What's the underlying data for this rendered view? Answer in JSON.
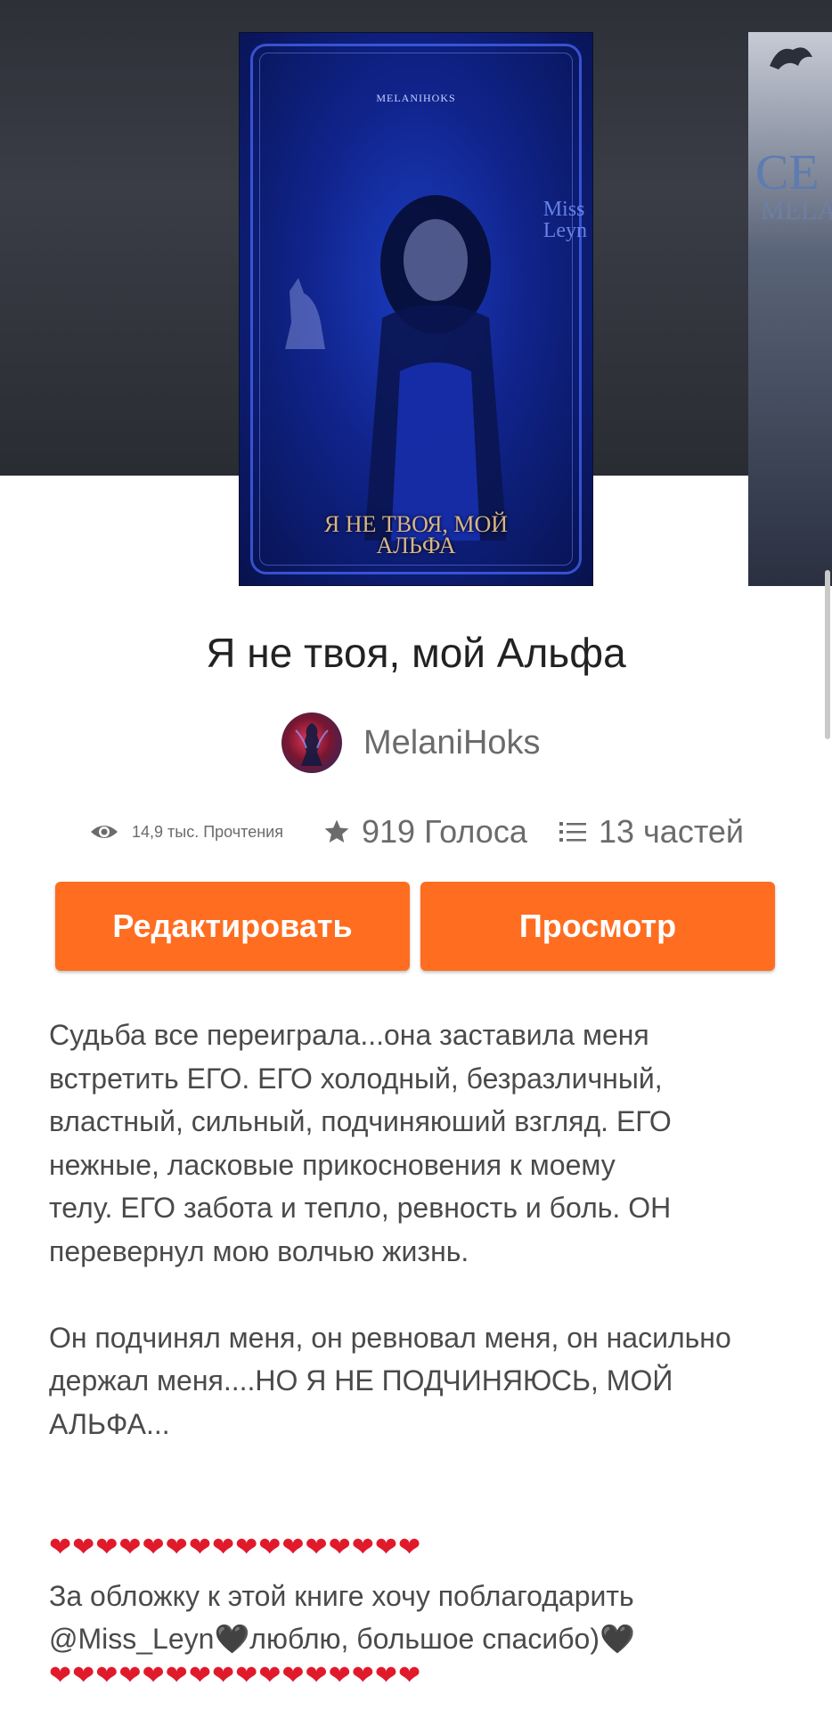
{
  "cover": {
    "author_label": "MELANIHOKS",
    "signature": "Miss\nLeyn",
    "title_line1": "Я НЕ ТВОЯ, МОЙ",
    "title_line2": "АЛЬФА"
  },
  "side_cover": {
    "text1": "CE",
    "text2": "MELA"
  },
  "story": {
    "title": "Я не твоя, мой Альфа",
    "author": "MelaniHoks"
  },
  "stats": {
    "reads": "14,9 тыс. Прочтения",
    "votes": "919 Голоса",
    "parts": "13 частей"
  },
  "buttons": {
    "edit": "Редактировать",
    "view": "Просмотр"
  },
  "description": {
    "para1": "Судьба все переиграла...она заставила меня\nвстретить ЕГО. ЕГО холодный, безразличный,\nвластный, сильный, подчиняюший взгляд. ЕГО\nнежные, ласковые прикосновения к моему\nтелу. ЕГО забота и тепло, ревность и боль. ОН\nперевернул мою волчью жизнь.",
    "para2": "Он подчинял меня, он ревновал меня, он насильно\nдержал меня....НО Я НЕ ПОДЧИНЯЮСЬ, МОЙ\nАЛЬФА..."
  },
  "thanks": {
    "hearts_top": "❤❤❤❤❤❤❤❤❤❤❤❤❤❤❤❤",
    "line1": "За обложку к этой книге хочу поблагодарить",
    "line2": "@Miss_Leyn🖤люблю, большое спасибо)🖤",
    "hearts_bottom": "❤❤❤❤❤❤❤❤❤❤❤❤❤❤❤❤"
  },
  "icons": {
    "reads": "eye-icon",
    "votes": "star-icon",
    "parts": "list-icon"
  },
  "colors": {
    "accent": "#ff6d20",
    "heart": "#e01a2b"
  }
}
